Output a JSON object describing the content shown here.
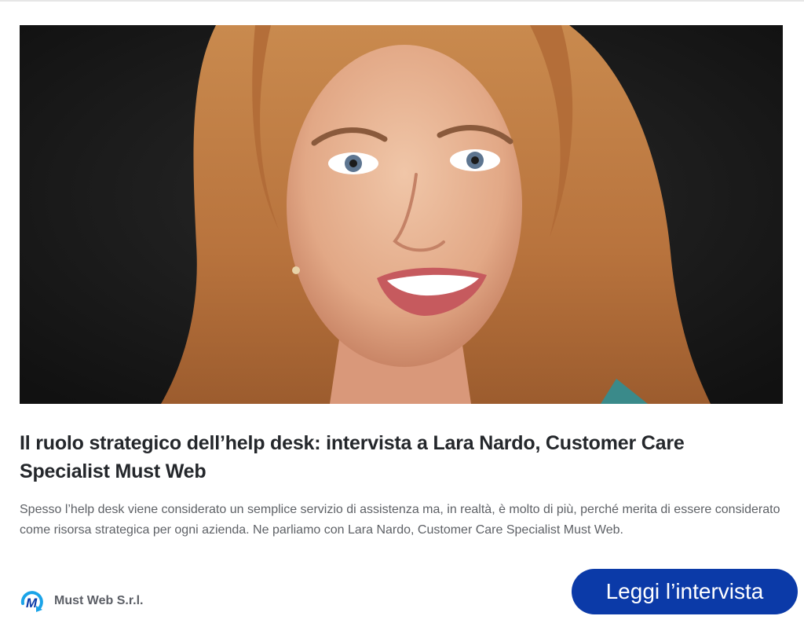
{
  "post": {
    "title": "Il ruolo strategico dell’help desk: intervista a Lara Nardo, Customer Care Specialist Must Web",
    "description": "Spesso l’help desk viene considerato un semplice servizio di assistenza ma, in realtà, è molto di più, perché merita di essere considerato come risorsa strategica per ogni azienda. Ne parliamo con Lara Nardo, Customer Care Specialist Must Web."
  },
  "company": {
    "name": "Must Web S.r.l.",
    "logo_icon": "must-web-logo-icon",
    "logo_letter": "M"
  },
  "cta": {
    "label": "Leggi l’intervista",
    "color": "#0b3aa8"
  },
  "hero": {
    "icon": "portrait-photo",
    "background_color": "#141414"
  }
}
